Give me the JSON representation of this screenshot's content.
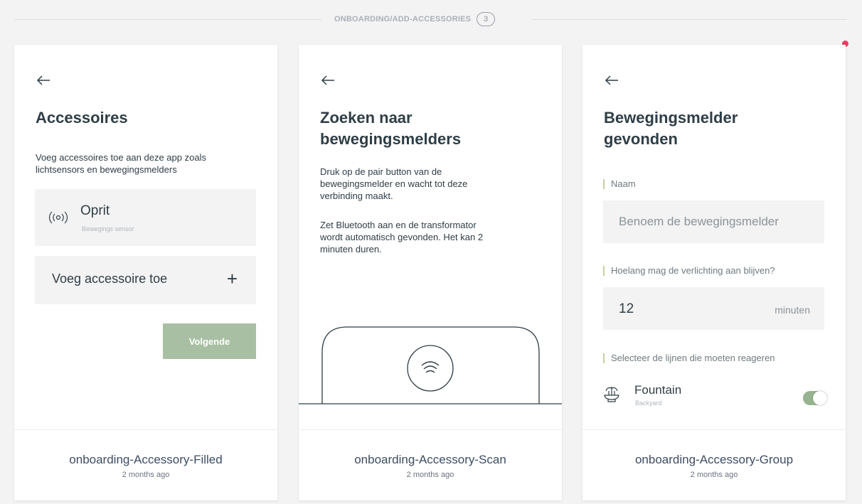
{
  "header": {
    "title": "ONBOARDING/ADD-ACCESSORIES",
    "count": "3"
  },
  "colors": {
    "accent_green": "#a9bfa3",
    "toggle_green": "#98b38f",
    "notification_dot": "#ee3a64",
    "label_bar": "#c9cfa2"
  },
  "cards": [
    {
      "name": "onboarding-Accessory-Filled",
      "time": "2 months ago",
      "screen": {
        "back_icon": "arrow-left-icon",
        "title": "Accessoires",
        "description_lines": [
          "Voeg accessoires toe aan deze app zoals",
          "lichtsensors en bewegingsmelders"
        ],
        "accessory": {
          "icon": "motion-sensor-icon",
          "title": "Oprit",
          "subtitle": "Bewegings sensor"
        },
        "add_label": "Voeg accessoire toe",
        "add_icon": "+",
        "next_button": "Volgende"
      }
    },
    {
      "name": "onboarding-Accessory-Scan",
      "time": "2 months ago",
      "screen": {
        "back_icon": "arrow-left-icon",
        "title_lines": [
          "Zoeken naar",
          "bewegingsmelders"
        ],
        "paragraph1_lines": [
          "Druk op de pair button van de",
          "bewegingsmelder en wacht tot deze",
          "verbinding maakt."
        ],
        "paragraph2_lines": [
          "Zet Bluetooth aan en de transformator",
          "wordt automatisch gevonden. Het kan 2",
          "minuten duren."
        ],
        "illustration_icon": "motion-sensor-device-icon"
      }
    },
    {
      "name": "onboarding-Accessory-Group",
      "time": "2 months ago",
      "screen": {
        "back_icon": "arrow-left-icon",
        "title_lines": [
          "Bewegingsmelder",
          "gevonden"
        ],
        "name_label": "Naam",
        "name_placeholder": "Benoem de bewegingsmelder",
        "duration_label": "Hoelang mag de verlichting aan blijven?",
        "duration_value": "12",
        "duration_unit": "minuten",
        "lines_label": "Selecteer de lijnen die moeten reageren",
        "line_item": {
          "icon": "fountain-icon",
          "title": "Fountain",
          "subtitle": "Backyard",
          "enabled": true
        }
      }
    }
  ]
}
